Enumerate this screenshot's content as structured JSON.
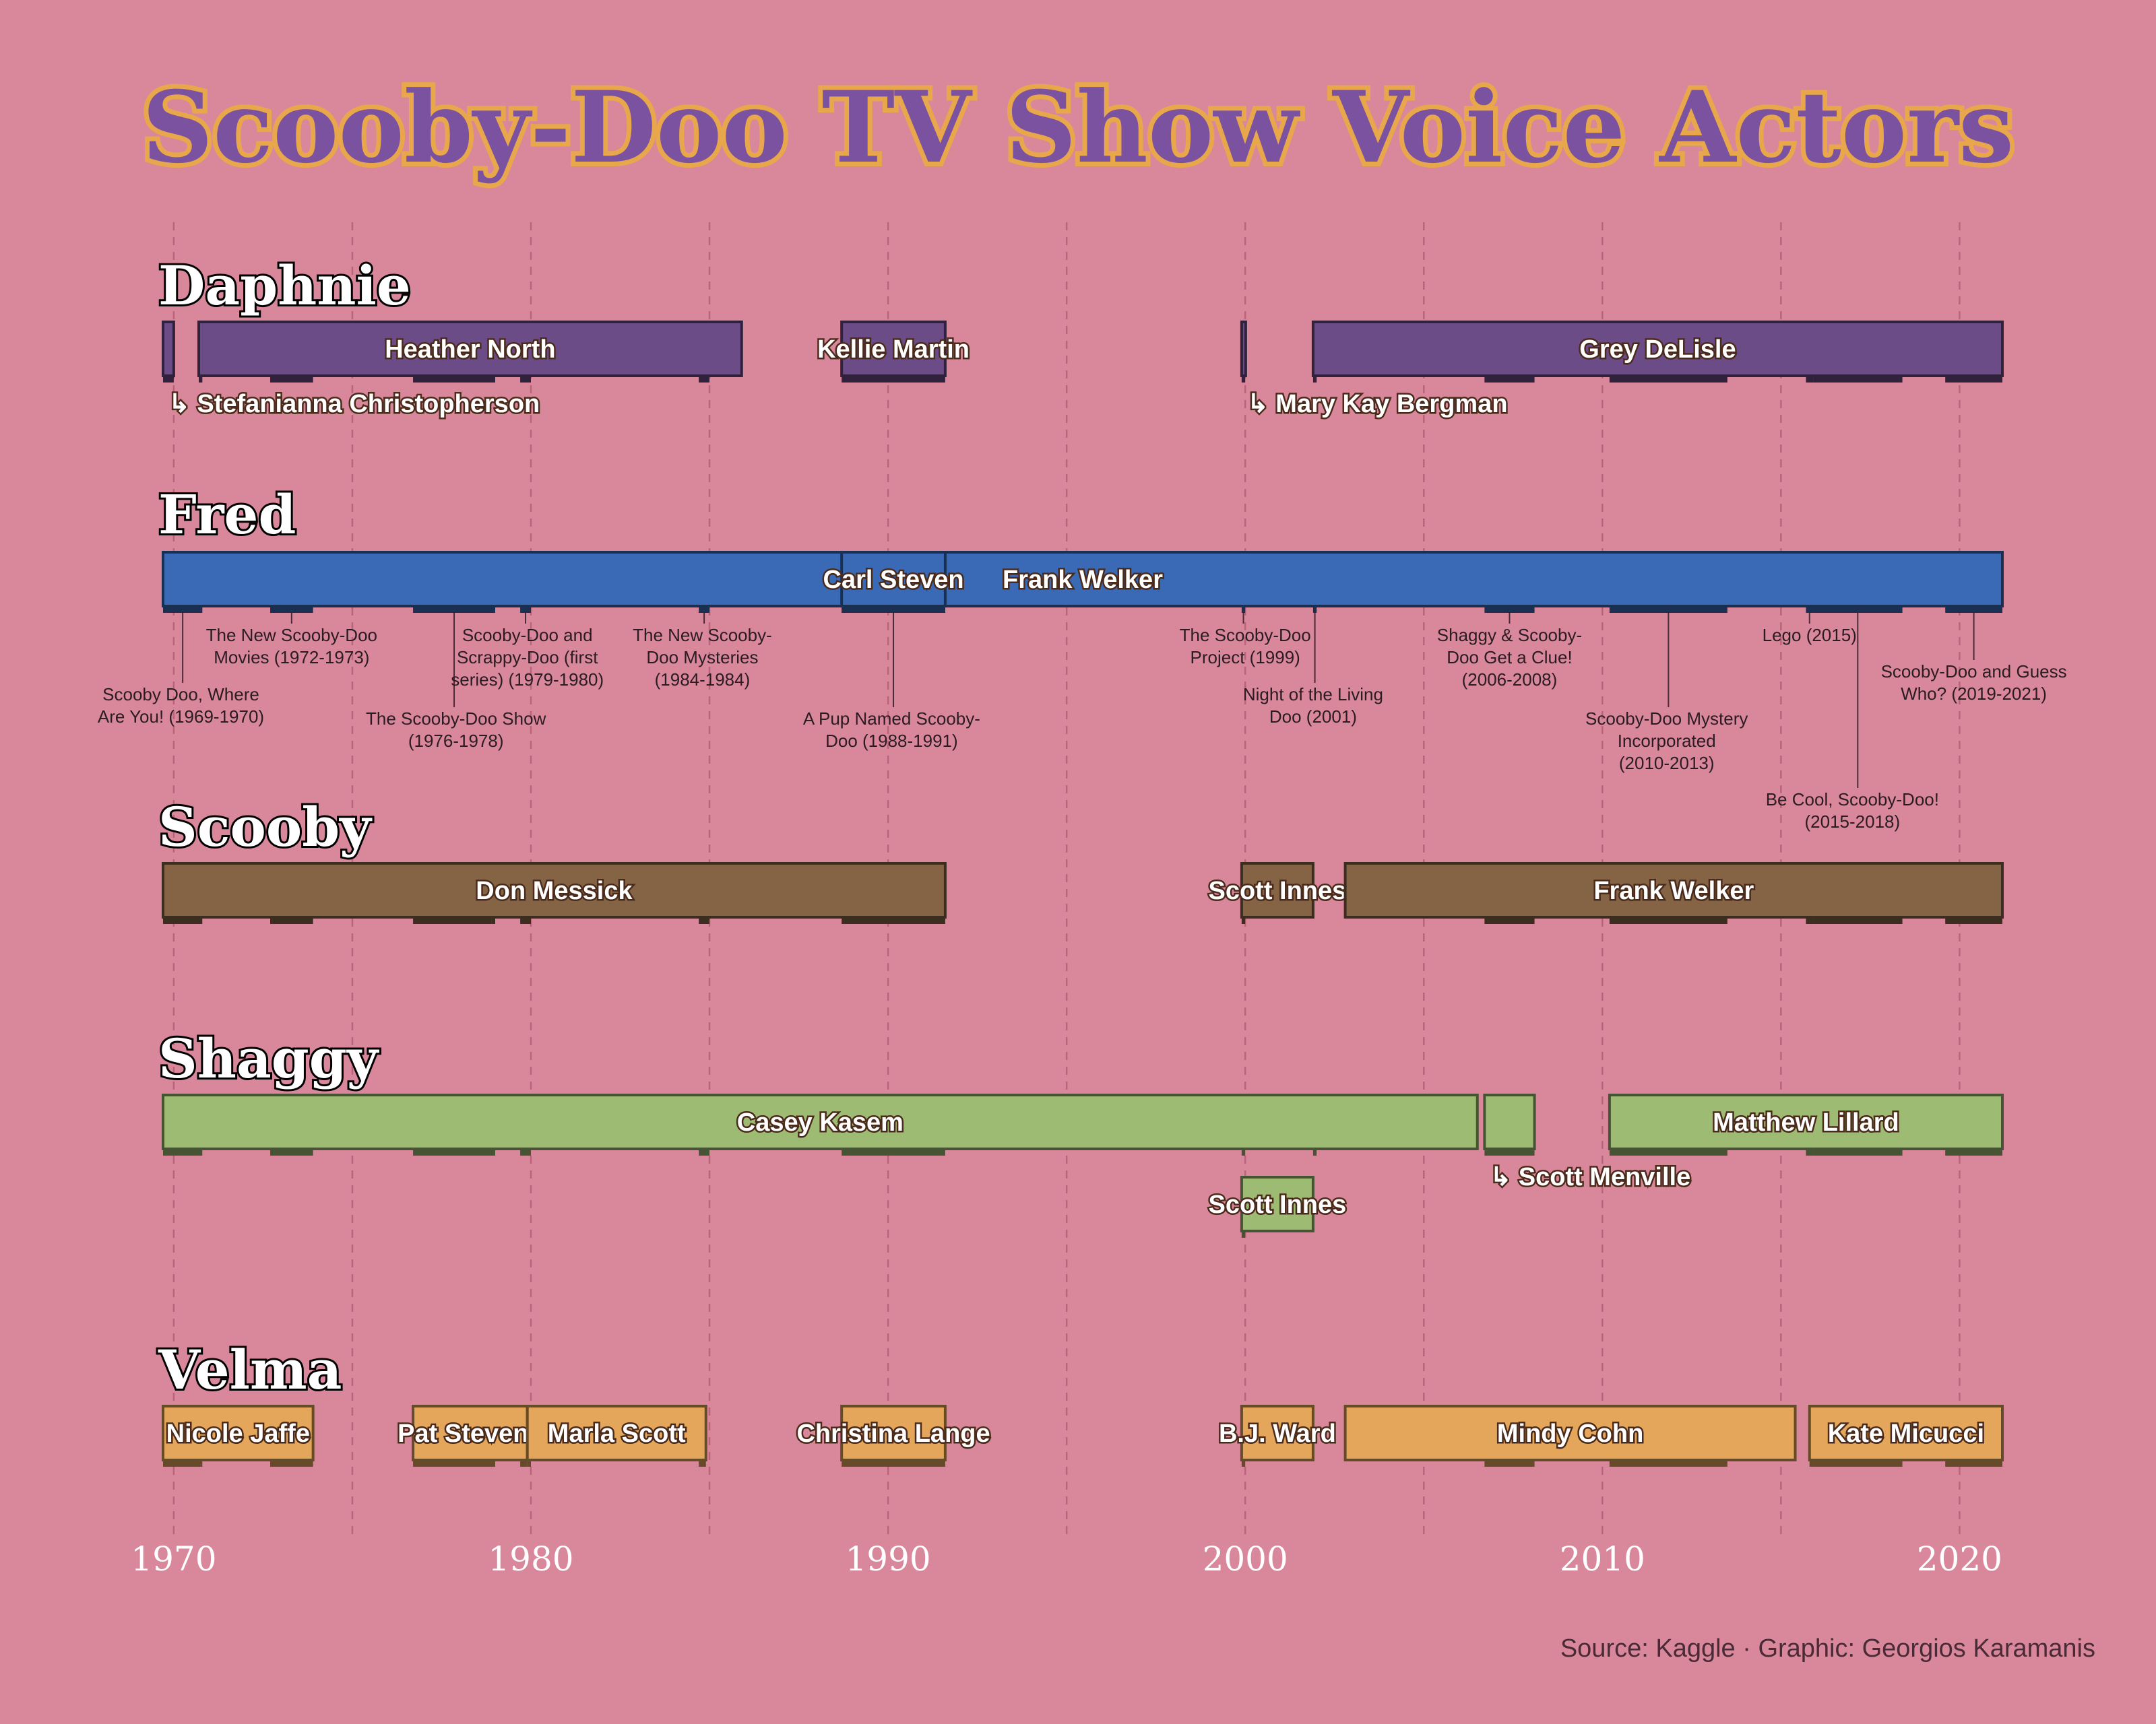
{
  "title": "Scooby-Doo TV Show Voice Actors",
  "caption": "Source: Kaggle · Graphic: Georgios Karamanis",
  "colors": {
    "background": "#d9889b",
    "Daphnie": "#6b4c87",
    "Fred": "#3a6ab6",
    "Scooby": "#846445",
    "Shaggy": "#9ebb73",
    "Velma": "#e3a65b"
  },
  "chart_data": {
    "type": "timeline",
    "x_axis": {
      "min": 1969.7,
      "max": 2021.2,
      "ticks": [
        1970,
        1980,
        1990,
        2000,
        2010,
        2020
      ]
    },
    "characters": [
      {
        "name": "Daphnie",
        "actors": [
          {
            "actor": "Stefanianna Christopherson",
            "start": 1969.7,
            "end": 1970.0,
            "label": "↳ Stefanianna Christopherson"
          },
          {
            "actor": "Heather North",
            "start": 1970.7,
            "end": 1985.9,
            "label": "Heather North"
          },
          {
            "actor": "Kellie Martin",
            "start": 1988.7,
            "end": 1991.6,
            "label": "Kellie Martin"
          },
          {
            "actor": "Mary Kay Bergman",
            "start": 1999.9,
            "end": 2000.0,
            "label": "↳ Mary Kay Bergman"
          },
          {
            "actor": "Grey DeLisle",
            "start": 2001.9,
            "end": 2021.2,
            "label": "Grey DeLisle"
          }
        ]
      },
      {
        "name": "Fred",
        "actors": [
          {
            "actor": "Frank Welker",
            "start": 1969.7,
            "end": 2021.2,
            "label": "Frank Welker"
          },
          {
            "actor": "Carl Steven",
            "start": 1988.7,
            "end": 1991.6,
            "label": "Carl Steven"
          }
        ]
      },
      {
        "name": "Scooby",
        "actors": [
          {
            "actor": "Don Messick",
            "start": 1969.7,
            "end": 1991.6,
            "label": "Don Messick"
          },
          {
            "actor": "Scott Innes",
            "start": 1999.9,
            "end": 2001.9,
            "label": "Scott Innes"
          },
          {
            "actor": "Frank Welker",
            "start": 2002.8,
            "end": 2021.2,
            "label": "Frank Welker"
          }
        ]
      },
      {
        "name": "Shaggy",
        "actors": [
          {
            "actor": "Casey Kasem",
            "start": 1969.7,
            "end": 2006.5,
            "label": "Casey Kasem"
          },
          {
            "actor": "Scott Menville",
            "start": 2006.7,
            "end": 2008.1,
            "label": "↳ Scott Menville"
          },
          {
            "actor": "Matthew Lillard",
            "start": 2010.2,
            "end": 2021.2,
            "label": "Matthew Lillard"
          },
          {
            "actor": "Scott Innes",
            "start": 1999.9,
            "end": 2001.9,
            "label": "Scott Innes"
          }
        ]
      },
      {
        "name": "Velma",
        "actors": [
          {
            "actor": "Nicole Jaffe",
            "start": 1969.7,
            "end": 1973.9,
            "label": "Nicole Jaffe"
          },
          {
            "actor": "Pat Stevens",
            "start": 1976.7,
            "end": 1979.9,
            "label": "Pat Stevens"
          },
          {
            "actor": "Marla Scott",
            "start": 1979.9,
            "end": 1984.9,
            "label": "Marla Scott"
          },
          {
            "actor": "Christina Lange",
            "start": 1988.7,
            "end": 1991.6,
            "label": "Christina Lange"
          },
          {
            "actor": "B.J. Ward",
            "start": 1999.9,
            "end": 2001.9,
            "label": "B.J. Ward"
          },
          {
            "actor": "Mindy Cohn",
            "start": 2002.8,
            "end": 2015.4,
            "label": "Mindy Cohn"
          },
          {
            "actor": "Kate Micucci",
            "start": 2015.8,
            "end": 2021.2,
            "label": "Kate Micucci"
          }
        ]
      }
    ],
    "shows": [
      {
        "name": "Scooby Doo, Where Are You! (1969-1970)",
        "start": 1969.7,
        "end": 1970.8,
        "label_x": 1970.2,
        "label_lines": [
          "Scooby Doo, Where",
          "Are You! (1969-1970)"
        ],
        "level": 2
      },
      {
        "name": "The New Scooby-Doo Movies (1972-1973)",
        "start": 1972.7,
        "end": 1973.9,
        "label_x": 1973.3,
        "label_lines": [
          "The New Scooby-Doo",
          "Movies (1972-1973)"
        ],
        "level": 0
      },
      {
        "name": "The Scooby-Doo Show (1976-1978)",
        "start": 1976.7,
        "end": 1979.0,
        "label_x": 1977.9,
        "label_lines": [
          "The Scooby-Doo Show",
          "(1976-1978)"
        ],
        "level": 3
      },
      {
        "name": "Scooby-Doo and Scrappy-Doo (first series) (1979-1980)",
        "start": 1979.7,
        "end": 1980.0,
        "label_x": 1979.9,
        "label_lines": [
          "Scooby-Doo and",
          "Scrappy-Doo (first",
          "series) (1979-1980)"
        ],
        "level": 0
      },
      {
        "name": "The New Scooby-Doo Mysteries (1984-1984)",
        "start": 1984.7,
        "end": 1985.0,
        "label_x": 1984.8,
        "label_lines": [
          "The New Scooby-",
          "Doo Mysteries",
          "(1984-1984)"
        ],
        "level": 0
      },
      {
        "name": "A Pup Named Scooby-Doo (1988-1991)",
        "start": 1988.7,
        "end": 1991.6,
        "label_x": 1990.1,
        "label_lines": [
          "A Pup Named Scooby-",
          "Doo (1988-1991)"
        ],
        "level": 3
      },
      {
        "name": "The Scooby-Doo Project (1999)",
        "start": 1999.9,
        "end": 2000.0,
        "label_x": 2000.0,
        "label_lines": [
          "The Scooby-Doo",
          "Project (1999)"
        ],
        "level": 0
      },
      {
        "name": "Night of the Living Doo (2001)",
        "start": 2001.9,
        "end": 2002.0,
        "label_x": 2001.9,
        "label_lines": [
          "Night of the Living",
          "Doo (2001)"
        ],
        "level": 2
      },
      {
        "name": "Shaggy & Scooby-Doo Get a Clue! (2006-2008)",
        "start": 2006.7,
        "end": 2008.1,
        "label_x": 2007.4,
        "label_lines": [
          "Shaggy & Scooby-",
          "Doo Get a Clue!",
          "(2006-2008)"
        ],
        "level": 0
      },
      {
        "name": "Scooby-Doo Mystery Incorporated (2010-2013)",
        "start": 2010.2,
        "end": 2013.5,
        "label_x": 2011.8,
        "label_lines": [
          "Scooby-Doo Mystery",
          "Incorporated",
          "(2010-2013)"
        ],
        "level": 3
      },
      {
        "name": "Lego (2015)",
        "start": 2015.7,
        "end": 2015.9,
        "label_x": 2015.8,
        "label_lines": [
          "Lego (2015)"
        ],
        "level": 0
      },
      {
        "name": "Be Cool, Scooby-Doo! (2015-2018)",
        "start": 2015.9,
        "end": 2018.4,
        "label_x": 2017.0,
        "label_lines": [
          "Be Cool, Scooby-Doo!",
          "(2015-2018)"
        ],
        "level": 4
      },
      {
        "name": "Scooby-Doo and Guess Who? (2019-2021)",
        "start": 2019.6,
        "end": 2021.2,
        "label_x": 2020.4,
        "label_lines": [
          "Scooby-Doo and Guess",
          "Who? (2019-2021)"
        ],
        "level": 1
      }
    ]
  }
}
